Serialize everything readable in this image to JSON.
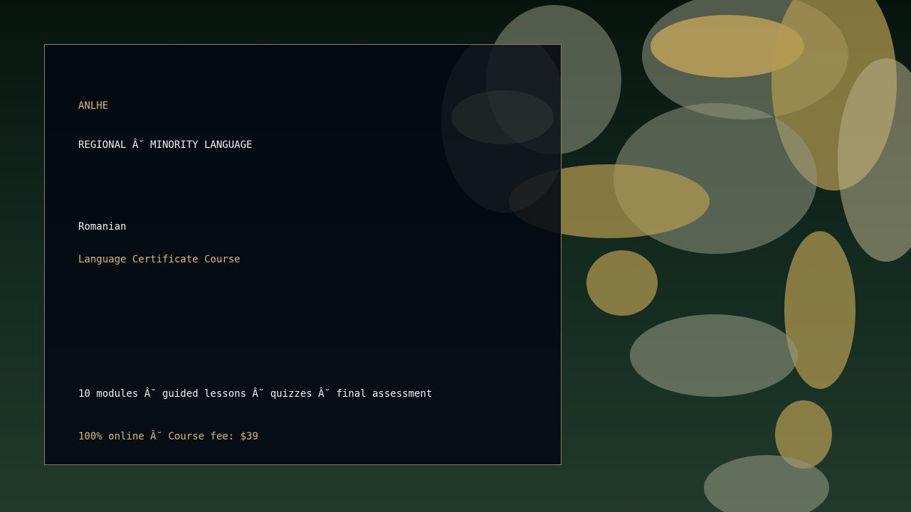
{
  "brand": "ANLHE",
  "category": "REGIONAL Â˘ MINORITY LANGUAGE",
  "language": "Romanian",
  "course_type": "Language Certificate Course",
  "details": "10 modules Â˘ guided lessons Â˘ quizzes Â˘ final assessment",
  "fee_line": "100% online Â˘ Course fee: $39",
  "colors": {
    "accent_gold": "#d9b777",
    "text_white": "#f1f1ef",
    "panel_border": "#8b7d54",
    "panel_bg": "#030812",
    "bg_dark_green": "#07140e"
  }
}
